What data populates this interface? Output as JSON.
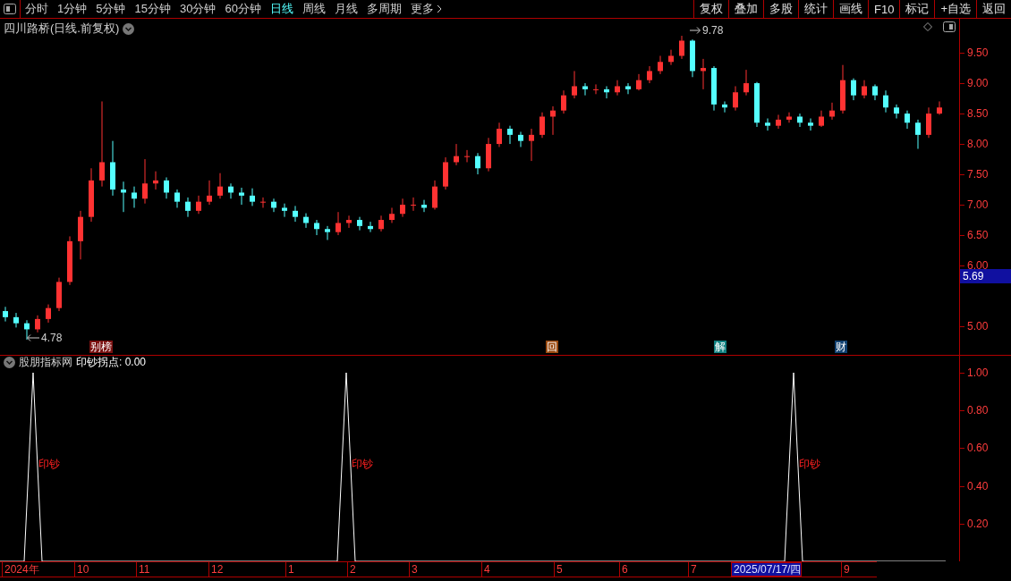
{
  "toolbar": {
    "periods": [
      {
        "label": "分时",
        "selected": false
      },
      {
        "label": "1分钟",
        "selected": false
      },
      {
        "label": "5分钟",
        "selected": false
      },
      {
        "label": "15分钟",
        "selected": false
      },
      {
        "label": "30分钟",
        "selected": false
      },
      {
        "label": "60分钟",
        "selected": false
      },
      {
        "label": "日线",
        "selected": true
      },
      {
        "label": "周线",
        "selected": false
      },
      {
        "label": "月线",
        "selected": false
      },
      {
        "label": "多周期",
        "selected": false
      },
      {
        "label": "更多",
        "selected": false
      }
    ],
    "buttons": [
      "复权",
      "叠加",
      "多股",
      "统计",
      "画线",
      "F10",
      "标记",
      "+自选",
      "返回"
    ]
  },
  "main_chart": {
    "title": "四川路桥(日线.前复权)",
    "high_label": "9.78",
    "low_label": "4.78",
    "last_price": "5.69",
    "events": [
      {
        "label": "别榜",
        "kind": "rank"
      },
      {
        "label": "回",
        "kind": "buyback"
      },
      {
        "label": "解",
        "kind": "unlock"
      },
      {
        "label": "财",
        "kind": "report"
      }
    ],
    "chart_data": {
      "type": "candlestick",
      "ylim": [
        4.53,
        10.06
      ],
      "yticks": [
        {
          "value": 9.5,
          "label": "9.50"
        },
        {
          "value": 9,
          "label": "9.00"
        },
        {
          "value": 8.5,
          "label": "8.50"
        },
        {
          "value": 8,
          "label": "8.00"
        },
        {
          "value": 7.5,
          "label": "7.50"
        },
        {
          "value": 7,
          "label": "7.00"
        },
        {
          "value": 6.5,
          "label": "6.50"
        },
        {
          "value": 6,
          "label": "6.00"
        },
        {
          "value": 5,
          "label": "5.00"
        }
      ],
      "categories": [
        null,
        null,
        null,
        null,
        null,
        null,
        null,
        null,
        null,
        null,
        null,
        null,
        null,
        null,
        null,
        null,
        null,
        null,
        null,
        null,
        null,
        null,
        null,
        null,
        null,
        null,
        null,
        null,
        null,
        null,
        null,
        null,
        null,
        null,
        null,
        null,
        null,
        null,
        null,
        null,
        null,
        null,
        null,
        null,
        null,
        null,
        null,
        null,
        null,
        null,
        null,
        null,
        null,
        null,
        null,
        null,
        null,
        null,
        null,
        null,
        null,
        null,
        null,
        null,
        null,
        null,
        null,
        null,
        null,
        null,
        null,
        null,
        null,
        null,
        null,
        null,
        null,
        null,
        null,
        null,
        null,
        null,
        null,
        null,
        null,
        null,
        null,
        null
      ],
      "ohlc": [
        [
          5.25,
          5.32,
          5.08,
          5.15
        ],
        [
          5.15,
          5.22,
          4.98,
          5.05
        ],
        [
          5.05,
          5.1,
          4.78,
          4.95
        ],
        [
          4.95,
          5.18,
          4.9,
          5.12
        ],
        [
          5.12,
          5.36,
          5.06,
          5.3
        ],
        [
          5.3,
          5.8,
          5.25,
          5.73
        ],
        [
          5.73,
          6.48,
          5.68,
          6.4
        ],
        [
          6.4,
          6.9,
          6.1,
          6.8
        ],
        [
          6.8,
          7.6,
          6.72,
          7.4
        ],
        [
          7.4,
          8.7,
          7.3,
          7.7
        ],
        [
          7.7,
          8.05,
          7.15,
          7.25
        ],
        [
          7.25,
          7.38,
          6.88,
          7.2
        ],
        [
          7.2,
          7.3,
          6.95,
          7.1
        ],
        [
          7.1,
          7.75,
          7.02,
          7.35
        ],
        [
          7.35,
          7.55,
          7.25,
          7.4
        ],
        [
          7.4,
          7.45,
          7.1,
          7.2
        ],
        [
          7.2,
          7.25,
          6.95,
          7.05
        ],
        [
          7.05,
          7.12,
          6.8,
          6.9
        ],
        [
          6.9,
          7.15,
          6.85,
          7.05
        ],
        [
          7.05,
          7.4,
          7.0,
          7.15
        ],
        [
          7.15,
          7.52,
          7.1,
          7.3
        ],
        [
          7.3,
          7.35,
          7.1,
          7.2
        ],
        [
          7.2,
          7.28,
          7.0,
          7.15
        ],
        [
          7.15,
          7.27,
          6.98,
          7.05
        ],
        [
          7.05,
          7.12,
          6.95,
          7.05
        ],
        [
          7.05,
          7.1,
          6.88,
          6.95
        ],
        [
          6.95,
          7.02,
          6.8,
          6.9
        ],
        [
          6.9,
          6.98,
          6.72,
          6.8
        ],
        [
          6.8,
          6.86,
          6.62,
          6.7
        ],
        [
          6.7,
          6.75,
          6.5,
          6.6
        ],
        [
          6.6,
          6.65,
          6.42,
          6.55
        ],
        [
          6.55,
          6.88,
          6.5,
          6.7
        ],
        [
          6.7,
          6.82,
          6.62,
          6.75
        ],
        [
          6.75,
          6.8,
          6.58,
          6.65
        ],
        [
          6.65,
          6.72,
          6.55,
          6.6
        ],
        [
          6.6,
          6.82,
          6.56,
          6.75
        ],
        [
          6.75,
          6.95,
          6.7,
          6.85
        ],
        [
          6.85,
          7.1,
          6.8,
          7.0
        ],
        [
          7.0,
          7.12,
          6.9,
          7.0
        ],
        [
          7.0,
          7.08,
          6.88,
          6.95
        ],
        [
          6.95,
          7.4,
          6.92,
          7.3
        ],
        [
          7.3,
          7.78,
          7.25,
          7.7
        ],
        [
          7.7,
          8.0,
          7.65,
          7.8
        ],
        [
          7.8,
          7.9,
          7.7,
          7.8
        ],
        [
          7.8,
          7.85,
          7.5,
          7.6
        ],
        [
          7.6,
          8.1,
          7.55,
          8.0
        ],
        [
          8.0,
          8.35,
          7.95,
          8.25
        ],
        [
          8.25,
          8.3,
          8.0,
          8.15
        ],
        [
          8.15,
          8.2,
          7.95,
          8.05
        ],
        [
          8.05,
          8.25,
          7.72,
          8.15
        ],
        [
          8.15,
          8.52,
          8.1,
          8.45
        ],
        [
          8.45,
          8.62,
          8.15,
          8.55
        ],
        [
          8.55,
          8.88,
          8.5,
          8.8
        ],
        [
          8.8,
          9.2,
          8.75,
          8.95
        ],
        [
          8.95,
          9.0,
          8.8,
          8.9
        ],
        [
          8.9,
          8.98,
          8.82,
          8.9
        ],
        [
          8.9,
          8.95,
          8.75,
          8.85
        ],
        [
          8.85,
          9.05,
          8.8,
          8.95
        ],
        [
          8.95,
          9.0,
          8.82,
          8.9
        ],
        [
          8.9,
          9.15,
          8.88,
          9.05
        ],
        [
          9.05,
          9.28,
          9.0,
          9.2
        ],
        [
          9.2,
          9.45,
          9.15,
          9.35
        ],
        [
          9.35,
          9.55,
          9.3,
          9.45
        ],
        [
          9.45,
          9.78,
          9.4,
          9.7
        ],
        [
          9.7,
          9.72,
          9.1,
          9.2
        ],
        [
          9.2,
          9.4,
          8.9,
          9.25
        ],
        [
          9.25,
          9.28,
          8.55,
          8.65
        ],
        [
          8.65,
          8.7,
          8.52,
          8.6
        ],
        [
          8.6,
          8.95,
          8.55,
          8.85
        ],
        [
          8.85,
          9.22,
          8.8,
          9.0
        ],
        [
          9.0,
          9.02,
          8.28,
          8.35
        ],
        [
          8.35,
          8.42,
          8.22,
          8.3
        ],
        [
          8.3,
          8.48,
          8.25,
          8.4
        ],
        [
          8.4,
          8.52,
          8.35,
          8.45
        ],
        [
          8.45,
          8.5,
          8.28,
          8.35
        ],
        [
          8.35,
          8.42,
          8.22,
          8.3
        ],
        [
          8.3,
          8.55,
          8.28,
          8.45
        ],
        [
          8.45,
          8.68,
          8.4,
          8.55
        ],
        [
          8.55,
          9.3,
          8.5,
          9.05
        ],
        [
          9.05,
          9.08,
          8.72,
          8.8
        ],
        [
          8.8,
          9.05,
          8.75,
          8.95
        ],
        [
          8.95,
          8.98,
          8.72,
          8.8
        ],
        [
          8.8,
          8.88,
          8.52,
          8.6
        ],
        [
          8.6,
          8.65,
          8.42,
          8.5
        ],
        [
          8.5,
          8.55,
          8.25,
          8.35
        ],
        [
          8.35,
          8.4,
          7.92,
          8.15
        ],
        [
          8.15,
          8.6,
          8.1,
          8.5
        ],
        [
          8.5,
          8.7,
          8.48,
          8.6
        ]
      ]
    }
  },
  "indicator": {
    "title": "股朋指标网",
    "readout": ": 0.00",
    "signals": [
      {
        "label": "印钞"
      },
      {
        "label": "印钞"
      },
      {
        "label": "印钞"
      }
    ],
    "chart_data": {
      "type": "line",
      "categories": [
        null,
        null,
        null,
        null,
        null,
        null,
        null,
        null,
        null,
        null,
        null,
        null,
        null,
        null,
        null,
        null,
        null,
        null,
        null,
        null,
        null,
        null,
        null,
        null,
        null,
        null,
        null,
        null,
        null,
        null,
        null,
        null,
        null,
        null,
        null,
        null,
        null,
        null,
        null,
        null,
        null,
        null,
        null,
        null,
        null,
        null,
        null,
        null,
        null,
        null,
        null,
        null,
        null,
        null,
        null,
        null,
        null,
        null,
        null,
        null,
        null,
        null,
        null,
        null,
        null,
        null,
        null,
        null,
        null,
        null,
        null,
        null,
        null,
        null,
        null,
        null,
        null,
        null,
        null,
        null,
        null,
        null,
        null,
        null,
        null,
        null,
        null,
        null,
        null,
        null,
        null,
        null,
        null,
        null,
        null,
        null,
        null,
        null,
        null,
        null,
        null,
        null,
        null,
        null,
        null,
        null,
        null
      ],
      "ylim": [
        0,
        1.09
      ],
      "yticks": [
        {
          "value": 1,
          "label": "1.00"
        },
        {
          "value": 0.8,
          "label": "0.80"
        },
        {
          "value": 0.6,
          "label": "0.60"
        },
        {
          "value": 0.4,
          "label": "0.40"
        },
        {
          "value": 0.2,
          "label": "0.20"
        }
      ],
      "series": [
        {
          "name": "印钞拐点",
          "color": "#ffffff",
          "values": [
            0,
            0,
            0,
            0,
            1,
            0,
            0,
            0,
            0,
            0,
            0,
            0,
            0,
            0,
            0,
            0,
            0,
            0,
            0,
            0,
            0,
            0,
            0,
            0,
            0,
            0,
            0,
            0,
            0,
            0,
            0,
            0,
            0,
            0,
            0,
            0,
            0,
            0,
            0,
            1,
            0,
            0,
            0,
            0,
            0,
            0,
            0,
            0,
            0,
            0,
            0,
            0,
            0,
            0,
            0,
            0,
            0,
            0,
            0,
            0,
            0,
            0,
            0,
            0,
            0,
            0,
            0,
            0,
            0,
            0,
            0,
            0,
            0,
            0,
            0,
            0,
            0,
            0,
            0,
            0,
            0,
            0,
            0,
            0,
            0,
            0,
            0,
            0,
            0,
            1,
            0,
            0,
            0,
            0,
            0,
            0,
            0,
            0,
            0,
            0,
            0,
            0,
            0,
            0,
            0,
            0,
            0
          ]
        }
      ]
    }
  },
  "x_axis": {
    "labels": [
      {
        "label": "2024年",
        "selected": false
      },
      {
        "label": "10",
        "selected": false
      },
      {
        "label": "11",
        "selected": false
      },
      {
        "label": "12",
        "selected": false
      },
      {
        "label": "1",
        "selected": false
      },
      {
        "label": "2",
        "selected": false
      },
      {
        "label": "3",
        "selected": false
      },
      {
        "label": "4",
        "selected": false
      },
      {
        "label": "5",
        "selected": false
      },
      {
        "label": "6",
        "selected": false
      },
      {
        "label": "7",
        "selected": false
      },
      {
        "label": "2025/07/17/四",
        "selected": true
      },
      {
        "label": "9",
        "selected": false
      }
    ]
  }
}
